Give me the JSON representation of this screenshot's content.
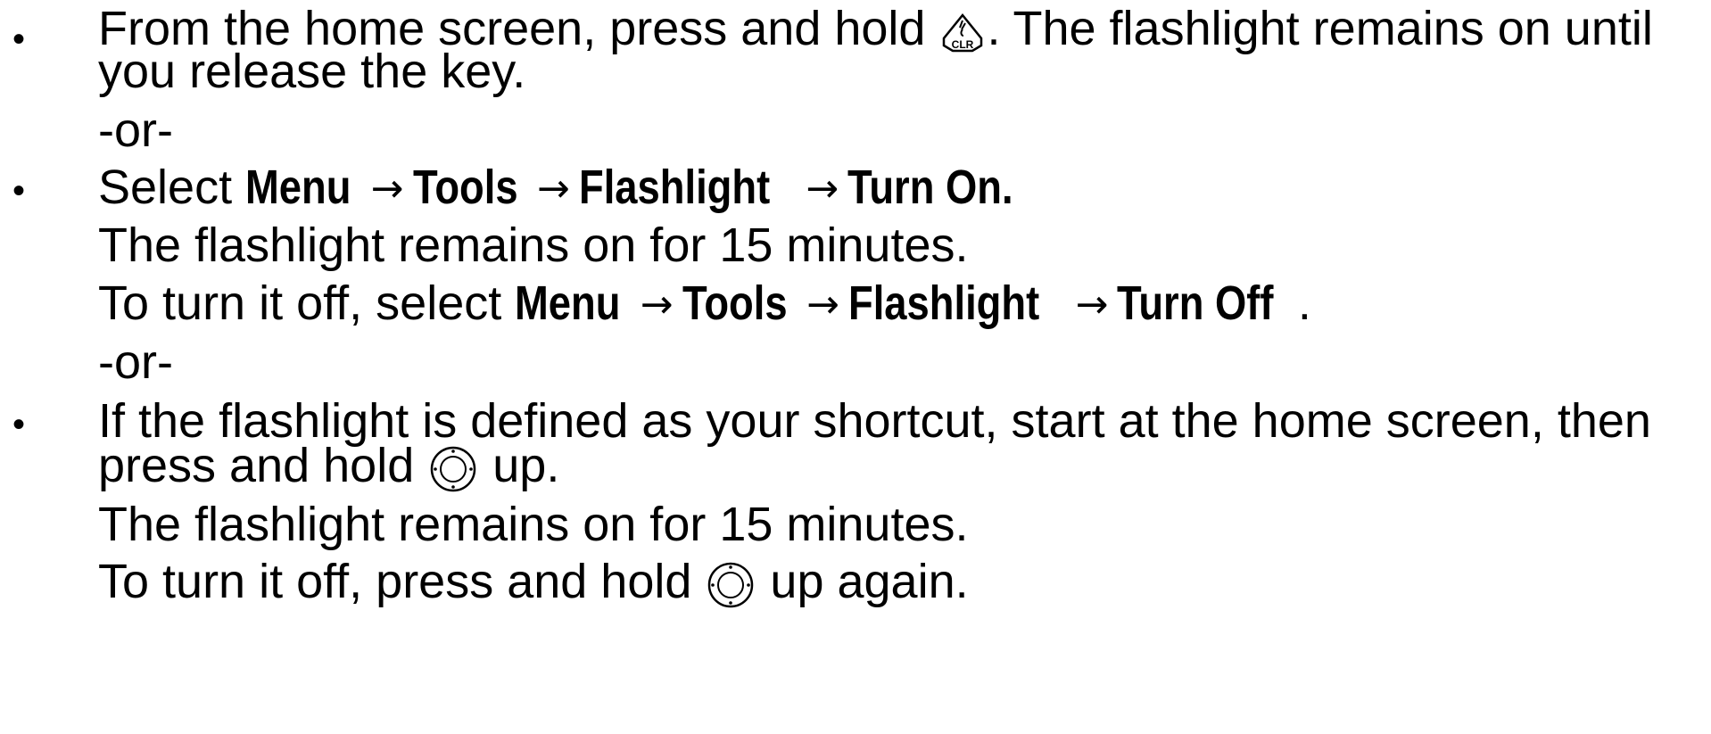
{
  "bullets": {
    "glyph": "•"
  },
  "step1": {
    "text_before_icon": "From the home screen, press and hold ",
    "icon": "clr-key-icon",
    "icon_label": "CLR",
    "text_after_icon": ". The flashlight remains on until",
    "line2": "you release the key."
  },
  "or1": "-or-",
  "step2": {
    "select_prefix": "Select ",
    "path": [
      "Menu",
      "Tools",
      "Flashlight",
      "Turn On."
    ],
    "arrow": "→",
    "note": "The flashlight remains on for 15 minutes.",
    "off_prefix": "To turn it off, select ",
    "off_path": [
      "Menu",
      "Tools",
      "Flashlight",
      "Turn Off"
    ],
    "off_suffix": "."
  },
  "or2": "-or-",
  "step3": {
    "line1": "If the flashlight is defined as your shortcut, start at the home screen, then",
    "line2_before_icon": "press and hold ",
    "icon": "navigation-key-icon",
    "line2_after_icon": " up.",
    "note": "The flashlight remains on for 15 minutes.",
    "off_before_icon": "To turn it off, press and hold ",
    "off_after_icon": " up again."
  }
}
